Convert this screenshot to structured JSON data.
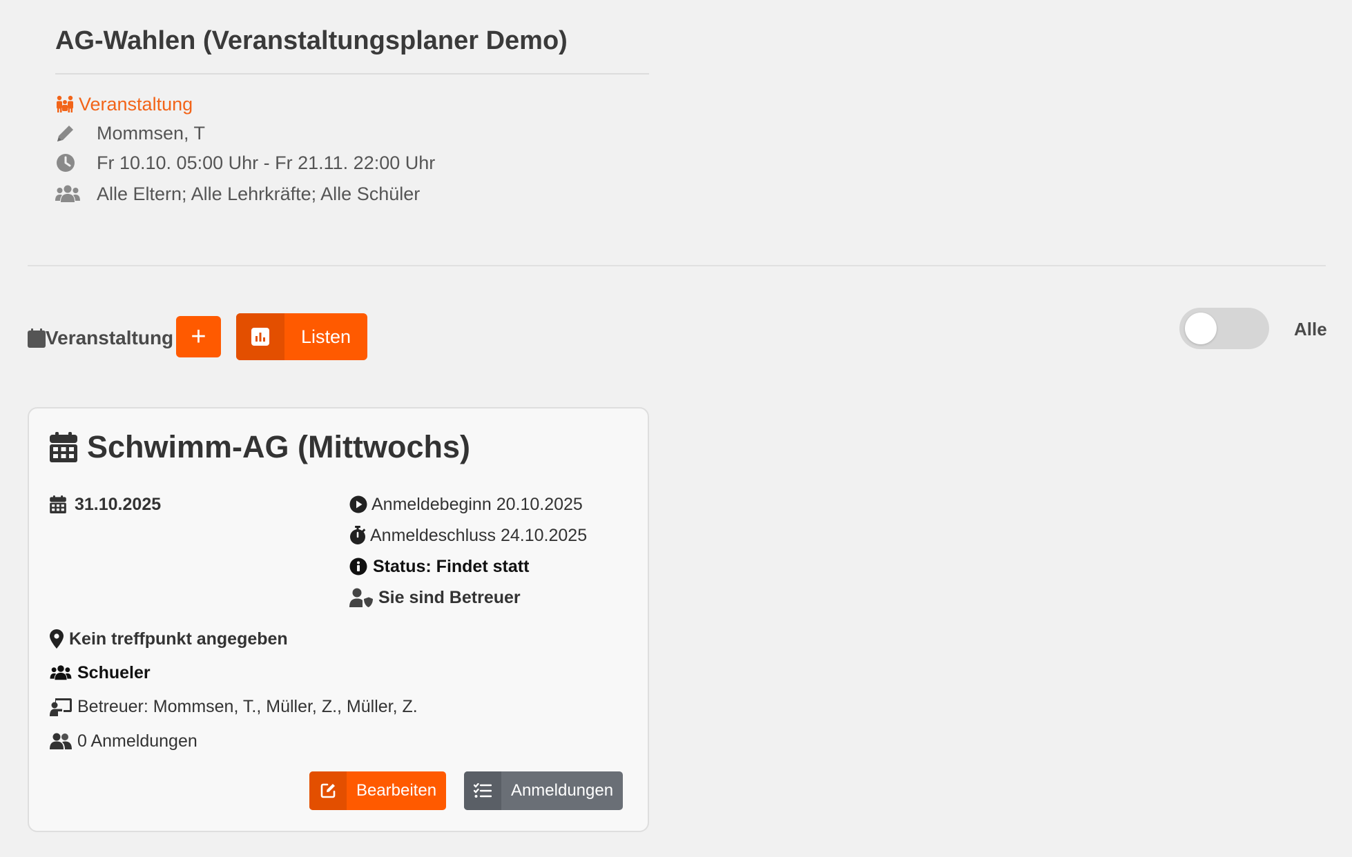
{
  "header": {
    "title": "AG-Wahlen (Veranstaltungsplaner Demo)",
    "type_link": "Veranstaltung",
    "author": "Mommsen, T",
    "period": "Fr 10.10. 05:00 Uhr - Fr 21.11. 22:00 Uhr",
    "audience": "Alle Eltern; Alle Lehrkräfte; Alle Schüler"
  },
  "toolbar": {
    "section_label": "Veranstaltung",
    "add_label": "+",
    "lists_label": "Listen",
    "toggle_label": "Alle",
    "toggle_on": false
  },
  "event_card": {
    "title": "Schwimm-AG (Mittwochs)",
    "date": "31.10.2025",
    "registration_start": "Anmeldebeginn 20.10.2025",
    "registration_end": "Anmeldeschluss 24.10.2025",
    "status": "Status: Findet statt",
    "role": "Sie sind Betreuer",
    "meeting_point": "Kein treffpunkt angegeben",
    "group": "Schueler",
    "supervisors": "Betreuer: Mommsen, T., Müller, Z., Müller, Z.",
    "registrations": "0 Anmeldungen",
    "edit_label": "Bearbeiten",
    "registrations_button_label": "Anmeldungen"
  },
  "colors": {
    "accent": "#ff5a00",
    "accent_dark": "#e34f00",
    "link": "#f26419",
    "secondary_button": "#6a6f76",
    "background": "#f1f1f1"
  },
  "icons": {
    "type_link": "people-group-icon",
    "author": "pencil-icon",
    "period": "clock-icon",
    "audience": "users-icon",
    "section_label": "calendar-icon",
    "lists_button": "chart-icon",
    "card_title": "calendar-icon",
    "date": "calendar-icon",
    "registration_start": "play-circle-icon",
    "registration_end": "stopwatch-icon",
    "status": "info-circle-icon",
    "role": "user-shield-icon",
    "meeting_point": "map-pin-icon",
    "group": "users-icon",
    "supervisors": "chalkboard-teacher-icon",
    "registrations": "user-group-icon",
    "edit_button": "edit-icon",
    "registrations_button": "list-check-icon"
  }
}
